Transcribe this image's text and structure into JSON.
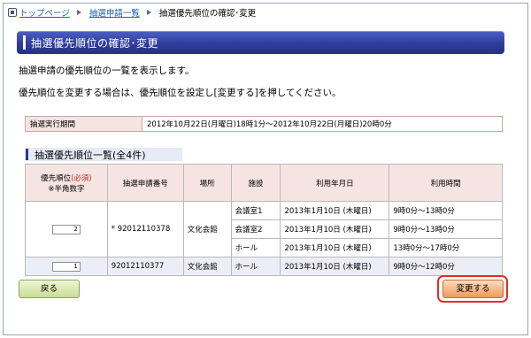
{
  "breadcrumb": {
    "home": "トップページ",
    "list": "抽選申請一覧",
    "current": "抽選優先順位の確認･変更"
  },
  "title": "抽選優先順位の確認･変更",
  "intro": {
    "line1": "抽選申請の優先順位の一覧を表示します。",
    "line2": "優先順位を変更する場合は、優先順位を設定し[変更する]を押してください。"
  },
  "period": {
    "label": "抽選実行期間",
    "value": "2012年10月22日(月曜日)18時1分～2012年10月22日(月曜日)20時0分"
  },
  "section_title": "抽選優先順位一覧(全4件)",
  "table": {
    "headers": {
      "priority": "優先順位",
      "required": "(必須)",
      "priority_note": "※半角数字",
      "app_no": "抽選申請番号",
      "place": "場所",
      "facility": "施設",
      "date": "利用年月日",
      "time": "利用時間"
    },
    "group_a": {
      "priority": "2",
      "app_no": "* 92012110378",
      "place": "文化会館",
      "rows": [
        {
          "facility": "会議室1",
          "date": "2013年1月10日 (木曜日)",
          "time": "9時0分～13時0分"
        },
        {
          "facility": "会議室2",
          "date": "2013年1月10日 (木曜日)",
          "time": "9時0分～13時0分"
        },
        {
          "facility": "ホール",
          "date": "2013年1月10日 (木曜日)",
          "time": "13時0分～17時0分"
        }
      ]
    },
    "group_b": {
      "priority": "1",
      "app_no": "92012110377",
      "place": "文化会館",
      "facility": "ホール",
      "date": "2013年1月10日 (木曜日)",
      "time": "9時0分～12時0分"
    }
  },
  "buttons": {
    "back": "戻る",
    "change": "変更する"
  },
  "colors": {
    "title_bar": "#2f3d9c",
    "highlight": "#e52b21",
    "required": "#d0231b"
  }
}
